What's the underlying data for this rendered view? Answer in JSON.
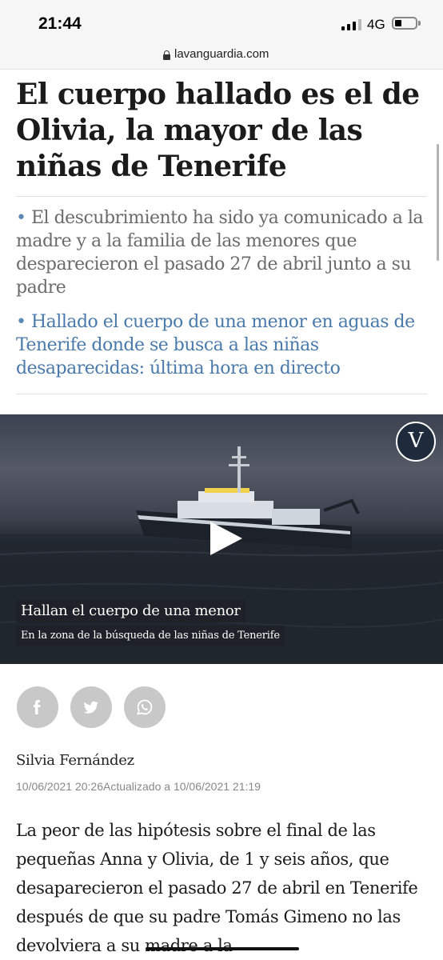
{
  "status_bar": {
    "time": "21:44",
    "network": "4G"
  },
  "browser": {
    "url": "lavanguardia.com"
  },
  "article": {
    "headline": "El cuerpo hallado es el de Olivia, la mayor de las niñas de Tenerife",
    "bullets": [
      {
        "text": "El descubrimiento ha sido ya comunicado a la madre y a la familia de las menores que desparecieron el pasado 27 de abril junto a su padre"
      },
      {
        "text": "Hallado el cuerpo de una menor en aguas de Tenerife donde se busca a las niñas desaparecidas: última hora en directo"
      }
    ],
    "video": {
      "logo_letter": "V",
      "caption_title": "Hallan el cuerpo de una menor",
      "caption_subtitle": "En la zona de la búsqueda de las niñas de Tenerife"
    },
    "share_icons": [
      "facebook-icon",
      "twitter-icon",
      "whatsapp-icon"
    ],
    "author": "Silvia Fernández",
    "published": "10/06/2021 20:26",
    "updated": "Actualizado a 10/06/2021 21:19",
    "body": "La peor de las hipótesis sobre el final de las pequeñas Anna y Olivia, de 1 y seis años, que desaparecieron el pasado 27 de abril en Tenerife después de que su padre Tomás Gimeno no las devolviera a su madre a la"
  },
  "colors": {
    "bullet_link": "#4a7aab",
    "bullet_gray": "#6b6b6b",
    "share_bg": "#c8c8c8",
    "logo_bg": "#1f2a3d"
  }
}
